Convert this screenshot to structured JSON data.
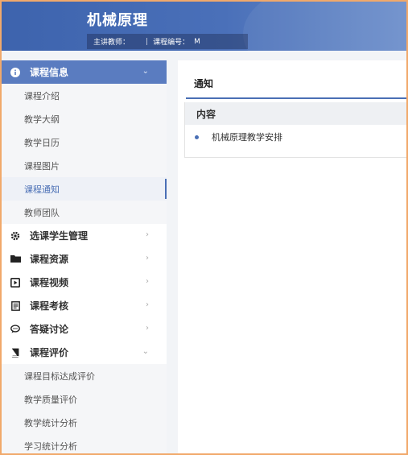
{
  "header": {
    "course_title": "机械原理",
    "teacher_label": "主讲教师：",
    "teacher_value": "",
    "separator": "|",
    "code_label": "课程编号：",
    "code_value": "M"
  },
  "sidebar": {
    "groups": [
      {
        "label": "课程信息",
        "icon": "info-icon",
        "expanded": true,
        "items": [
          "课程介绍",
          "教学大纲",
          "教学日历",
          "课程图片",
          "课程通知",
          "教师团队"
        ]
      },
      {
        "label": "选课学生管理",
        "icon": "gear-icon",
        "expanded": false
      },
      {
        "label": "课程资源",
        "icon": "folder-icon",
        "expanded": false
      },
      {
        "label": "课程视频",
        "icon": "video-icon",
        "expanded": false
      },
      {
        "label": "课程考核",
        "icon": "document-icon",
        "expanded": false
      },
      {
        "label": "答疑讨论",
        "icon": "chat-icon",
        "expanded": false
      },
      {
        "label": "课程评价",
        "icon": "book-icon",
        "expanded": true,
        "items": [
          "课程目标达成评价",
          "教学质量评价",
          "教学统计分析",
          "学习统计分析"
        ]
      }
    ],
    "selected_item": "课程通知"
  },
  "main": {
    "title": "通知",
    "table_header": "内容",
    "rows": [
      "机械原理教学安排"
    ]
  },
  "colors": {
    "accent": "#4a6fb5",
    "active_bg": "#5a7cc0",
    "frame": "#f1a96b"
  }
}
